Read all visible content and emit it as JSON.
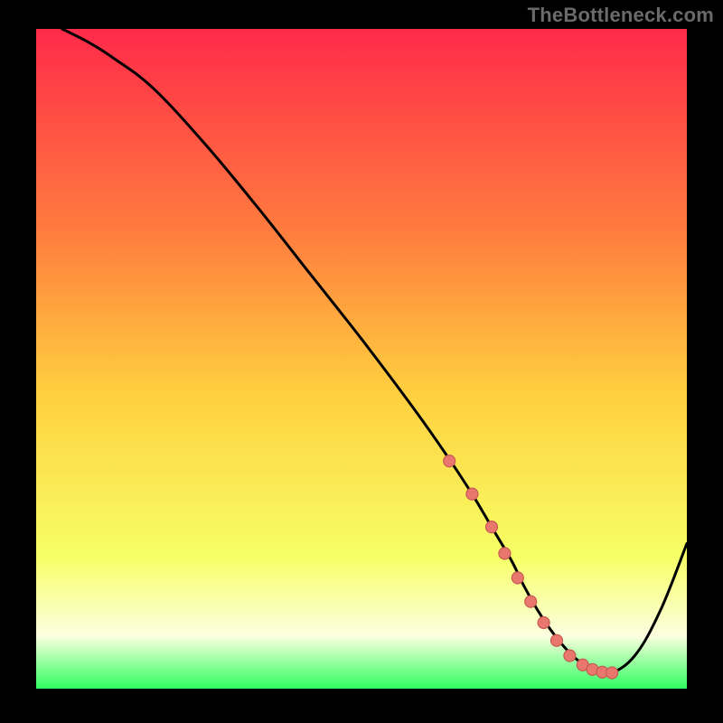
{
  "watermark": "TheBottleneck.com",
  "colors": {
    "page_bg": "#000000",
    "gradient_top": "#ff2a4a",
    "gradient_mid_upper": "#ff7a3e",
    "gradient_mid": "#ffcf3f",
    "gradient_lower": "#f7ff66",
    "gradient_pale": "#fcffe0",
    "gradient_bottom": "#2fff60",
    "curve": "#000000",
    "marker_fill": "#e9776d",
    "marker_stroke": "#c55b52"
  },
  "chart_data": {
    "type": "line",
    "title": "",
    "xlabel": "",
    "ylabel": "",
    "xlim": [
      0,
      100
    ],
    "ylim": [
      0,
      100
    ],
    "series": [
      {
        "name": "curve",
        "x": [
          4,
          8,
          12,
          18,
          26,
          34,
          42,
          50,
          58,
          63,
          67,
          70,
          73,
          75,
          77,
          79,
          81,
          83,
          85,
          88,
          92,
          96,
          100
        ],
        "y": [
          100,
          98,
          95.5,
          91,
          82.5,
          73,
          63,
          53,
          42.5,
          35.5,
          29.5,
          24.5,
          19.5,
          15.5,
          12,
          9,
          6.5,
          4.5,
          3.2,
          2.3,
          5,
          12,
          22
        ]
      }
    ],
    "markers": {
      "name": "highlighted-range",
      "x": [
        63.5,
        67,
        70,
        72,
        74,
        76,
        78,
        80,
        82,
        84,
        85.5,
        87,
        88.5
      ],
      "y": [
        34.5,
        29.5,
        24.5,
        20.5,
        16.8,
        13.2,
        10,
        7.3,
        5,
        3.6,
        2.9,
        2.5,
        2.4
      ]
    }
  }
}
